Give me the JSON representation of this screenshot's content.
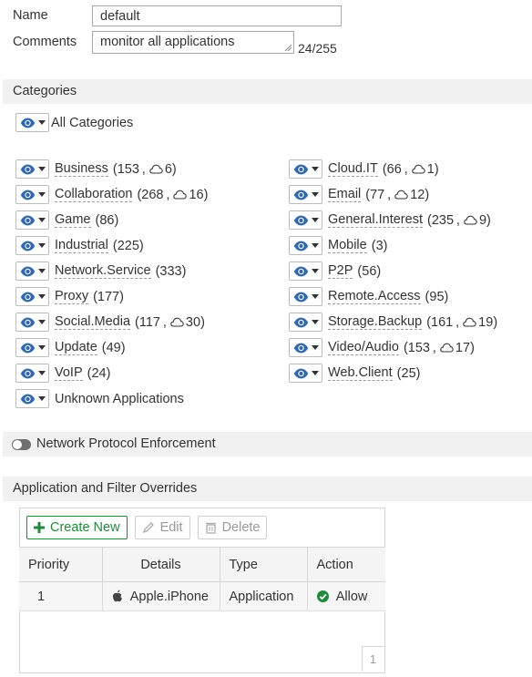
{
  "form": {
    "name_label": "Name",
    "name_value": "default",
    "comments_label": "Comments",
    "comments_value": "monitor all applications",
    "comments_count": "24/255"
  },
  "categories_section": {
    "title": "Categories",
    "all_label": "All Categories",
    "left": [
      {
        "name": "Business",
        "count": "153",
        "cloud": "6"
      },
      {
        "name": "Collaboration",
        "count": "268",
        "cloud": "16"
      },
      {
        "name": "Game",
        "count": "86",
        "cloud": null
      },
      {
        "name": "Industrial",
        "count": "225",
        "cloud": null
      },
      {
        "name": "Network.Service",
        "count": "333",
        "cloud": null
      },
      {
        "name": "Proxy",
        "count": "177",
        "cloud": null
      },
      {
        "name": "Social.Media",
        "count": "117",
        "cloud": "30"
      },
      {
        "name": "Update",
        "count": "49",
        "cloud": null
      },
      {
        "name": "VoIP",
        "count": "24",
        "cloud": null
      }
    ],
    "right": [
      {
        "name": "Cloud.IT",
        "count": "66",
        "cloud": "1"
      },
      {
        "name": "Email",
        "count": "77",
        "cloud": "12"
      },
      {
        "name": "General.Interest",
        "count": "235",
        "cloud": "9"
      },
      {
        "name": "Mobile",
        "count": "3",
        "cloud": null
      },
      {
        "name": "P2P",
        "count": "56",
        "cloud": null
      },
      {
        "name": "Remote.Access",
        "count": "95",
        "cloud": null
      },
      {
        "name": "Storage.Backup",
        "count": "161",
        "cloud": "19"
      },
      {
        "name": "Video/Audio",
        "count": "153",
        "cloud": "17"
      },
      {
        "name": "Web.Client",
        "count": "25",
        "cloud": null
      }
    ],
    "unknown_label": "Unknown Applications"
  },
  "network_protocol": {
    "label": "Network Protocol Enforcement"
  },
  "overrides": {
    "title": "Application and Filter Overrides",
    "create_label": "Create New",
    "edit_label": "Edit",
    "delete_label": "Delete",
    "columns": [
      "Priority",
      "Details",
      "Type",
      "Action"
    ],
    "rows": [
      {
        "priority": "1",
        "details": "Apple.iPhone",
        "type": "Application",
        "action": "Allow"
      }
    ],
    "page": "1"
  },
  "colors": {
    "accent_green": "#1f8a3a",
    "eye_blue": "#2f68b2"
  }
}
